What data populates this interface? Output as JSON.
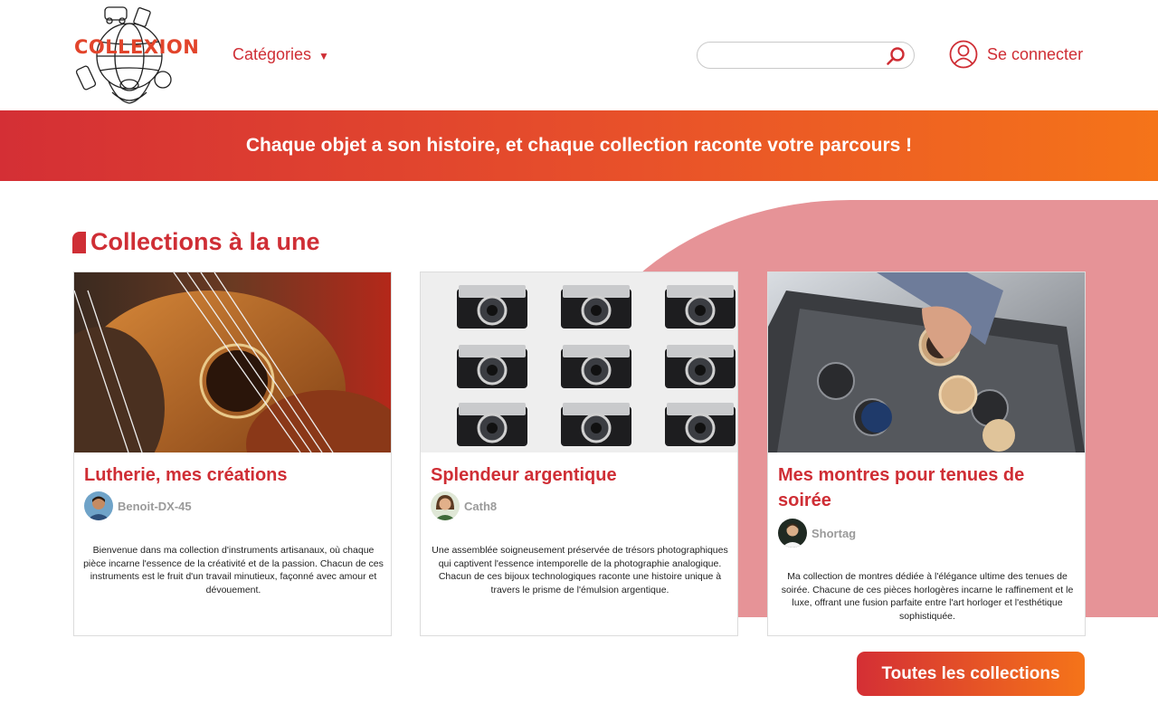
{
  "brand": {
    "logo_text": "COLLEXION",
    "accent": "#cf2e35",
    "gradient_start": "#d42f35",
    "gradient_end": "#f57419",
    "pink": "#e69397"
  },
  "header": {
    "categories_label": "Catégories",
    "search_placeholder": "",
    "login_label": "Se connecter",
    "icons": [
      "chevron-down-icon",
      "search-icon",
      "user-icon"
    ]
  },
  "banner": {
    "text": "Chaque objet a son histoire, et chaque collection raconte votre parcours !"
  },
  "featured": {
    "title": "Collections à la une",
    "cards": [
      {
        "title": "Lutherie, mes créations",
        "author": "Benoit-DX-45",
        "image": "guitars-photo",
        "description": "Bienvenue dans ma collection d'instruments artisanaux, où chaque pièce incarne l'essence de la créativité et de la passion. Chacun de ces instruments est le fruit d'un travail minutieux, façonné avec amour et dévouement."
      },
      {
        "title": "Splendeur argentique",
        "author": "Cath8",
        "image": "vintage-cameras-photo",
        "description": "Une assemblée soigneusement préservée de trésors photographiques qui captivent l'essence intemporelle de la photographie analogique. Chacun de ces bijoux technologiques raconte une histoire unique à travers le prisme de l'émulsion argentique."
      },
      {
        "title": "Mes montres pour tenues de soirée",
        "author": "Shortag",
        "image": "watch-box-photo",
        "description": "Ma collection de montres dédiée à l'élégance ultime des tenues de soirée. Chacune de ces pièces horlogères incarne le raffinement et le luxe, offrant une fusion parfaite entre l'art horloger et l'esthétique sophistiquée."
      }
    ]
  },
  "cta": {
    "label": "Toutes les collections"
  }
}
